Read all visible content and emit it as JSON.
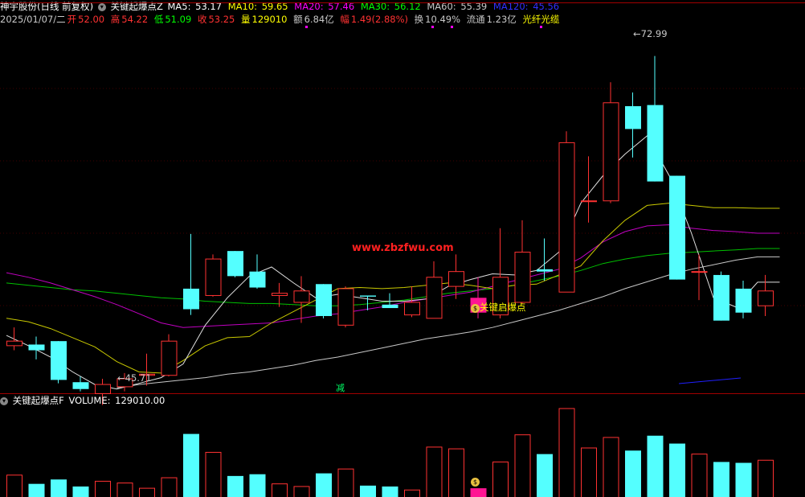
{
  "header": {
    "stock_name": "神宇股份(日线 前复权)",
    "indicator_name": "关键起爆点Z",
    "ma5": {
      "label": "MA5:",
      "value": "53.17",
      "color": "#ffffff"
    },
    "ma10": {
      "label": "MA10:",
      "value": "59.65",
      "color": "#ffff00"
    },
    "ma20": {
      "label": "MA20:",
      "value": "57.46",
      "color": "#ff00ff"
    },
    "ma30": {
      "label": "MA30:",
      "value": "56.12",
      "color": "#00ff00"
    },
    "ma60": {
      "label": "MA60:",
      "value": "55.39",
      "color": "#c0c0c0"
    },
    "ma120": {
      "label": "MA120:",
      "value": "45.56",
      "color": "#3030ff"
    }
  },
  "info": {
    "date": "2025/01/07/二",
    "open_label": "开",
    "open": "52.00",
    "high_label": "高",
    "high": "54.22",
    "low_label": "低",
    "low": "51.09",
    "close_label": "收",
    "close": "53.25",
    "vol_label": "量",
    "vol": "129010",
    "amount_label": "额",
    "amount": "6.84亿",
    "change_label": "幅",
    "change": "1.49(2.88%)",
    "turnover_label": "换",
    "turnover": "10.49%",
    "float_label": "流通",
    "float": "1.23亿",
    "concept": "光纤光缆"
  },
  "annotations": {
    "high_mark": "72.99",
    "low_mark": "45.71",
    "signal_label": "关键启爆点",
    "watermark": "www.zbzfwu.com",
    "reduce_badge": "减"
  },
  "volume_header": {
    "indicator_name": "关键起爆点F",
    "volume_label": "VOLUME:",
    "volume_value": "129010.00"
  },
  "colors": {
    "up": "#ff3232",
    "down": "#54ffff",
    "signal": "#ff1493",
    "border": "#a00000"
  },
  "chart_data": {
    "type": "candlestick",
    "price_range": [
      43.5,
      76.5
    ],
    "candles": [
      {
        "o": 47.6,
        "h": 49.2,
        "l": 47.2,
        "c": 48.0,
        "v": 25
      },
      {
        "o": 47.7,
        "h": 48.4,
        "l": 46.4,
        "c": 47.2,
        "v": 15
      },
      {
        "o": 48.0,
        "h": 48.0,
        "l": 44.3,
        "c": 44.6,
        "v": 20
      },
      {
        "o": 44.4,
        "h": 44.9,
        "l": 43.6,
        "c": 43.8,
        "v": 12
      },
      {
        "o": 43.4,
        "h": 44.7,
        "l": 42.4,
        "c": 44.2,
        "v": 18
      },
      {
        "o": 44.0,
        "h": 45.2,
        "l": 43.6,
        "c": 44.7,
        "v": 16
      },
      {
        "o": 45.0,
        "h": 46.9,
        "l": 44.1,
        "c": 45.1,
        "v": 10
      },
      {
        "o": 45.0,
        "h": 48.6,
        "l": 44.9,
        "c": 48.0,
        "v": 22
      },
      {
        "o": 52.6,
        "h": 57.4,
        "l": 50.3,
        "c": 50.8,
        "v": 72
      },
      {
        "o": 52.0,
        "h": 55.6,
        "l": 51.9,
        "c": 55.2,
        "v": 51
      },
      {
        "o": 55.9,
        "h": 55.9,
        "l": 53.6,
        "c": 53.7,
        "v": 24
      },
      {
        "o": 54.1,
        "h": 55.6,
        "l": 52.6,
        "c": 52.7,
        "v": 26
      },
      {
        "o": 52.0,
        "h": 53.1,
        "l": 51.0,
        "c": 52.2,
        "v": 15
      },
      {
        "o": 51.4,
        "h": 53.7,
        "l": 49.6,
        "c": 52.4,
        "v": 12
      },
      {
        "o": 53.0,
        "h": 53.0,
        "l": 50.0,
        "c": 50.2,
        "v": 27
      },
      {
        "o": 49.4,
        "h": 52.8,
        "l": 49.2,
        "c": 52.6,
        "v": 32
      },
      {
        "o": 52.0,
        "h": 52.0,
        "l": 50.7,
        "c": 51.9,
        "v": 13
      },
      {
        "o": 51.2,
        "h": 52.2,
        "l": 51.0,
        "c": 50.9,
        "v": 12
      },
      {
        "o": 50.3,
        "h": 52.8,
        "l": 50.1,
        "c": 51.4,
        "v": 8
      },
      {
        "o": 50.0,
        "h": 55.0,
        "l": 50.0,
        "c": 53.6,
        "v": 57
      },
      {
        "o": 52.8,
        "h": 55.6,
        "l": 51.7,
        "c": 54.1,
        "v": 55
      },
      {
        "o": 51.8,
        "h": 53.6,
        "l": 50.0,
        "c": 50.5,
        "v": 10
      },
      {
        "o": 50.3,
        "h": 57.9,
        "l": 50.0,
        "c": 53.6,
        "v": 40
      },
      {
        "o": 51.4,
        "h": 58.6,
        "l": 51.3,
        "c": 55.8,
        "v": 71
      },
      {
        "o": 54.3,
        "h": 57.0,
        "l": 53.3,
        "c": 54.1,
        "v": 49
      },
      {
        "o": 52.3,
        "h": 66.4,
        "l": 52.3,
        "c": 65.4,
        "v": 101
      },
      {
        "o": 60.3,
        "h": 64.2,
        "l": 58.4,
        "c": 60.3,
        "v": 56
      },
      {
        "o": 60.3,
        "h": 70.7,
        "l": 60.1,
        "c": 68.9,
        "v": 68
      },
      {
        "o": 68.6,
        "h": 69.8,
        "l": 64.1,
        "c": 66.6,
        "v": 53
      },
      {
        "o": 68.7,
        "h": 73.0,
        "l": 62.0,
        "c": 62.0,
        "v": 70
      },
      {
        "o": 62.5,
        "h": 57.4,
        "l": 59.7,
        "c": 53.4,
        "v": 61
      },
      {
        "o": 54.1,
        "h": 55.6,
        "l": 51.6,
        "c": 54.1,
        "v": 49
      },
      {
        "o": 53.8,
        "h": 54.1,
        "l": 49.8,
        "c": 49.8,
        "v": 40
      },
      {
        "o": 52.6,
        "h": 53.3,
        "l": 50.0,
        "c": 50.5,
        "v": 39
      },
      {
        "o": 51.1,
        "h": 53.8,
        "l": 50.2,
        "c": 52.4,
        "v": 42
      }
    ],
    "ma5": [
      48.5,
      47.6,
      46.6,
      45.3,
      44.2,
      43.8,
      44.3,
      44.8,
      46.0,
      49.4,
      51.8,
      53.7,
      54.5,
      53.1,
      51.8,
      52.1,
      51.8,
      51.5,
      51.5,
      51.7,
      52.8,
      53.4,
      53.9,
      53.8,
      54.2,
      55.8,
      60.1,
      62.5,
      64.4,
      66.0,
      62.5,
      57.5,
      51.8,
      51.0,
      53.17
    ],
    "ma10": [
      50.0,
      49.7,
      49.1,
      48.3,
      47.5,
      46.2,
      45.3,
      45.2,
      46.3,
      47.6,
      48.3,
      48.4,
      49.6,
      50.6,
      51.6,
      52.6,
      52.7,
      52.6,
      52.7,
      52.9,
      53.1,
      52.9,
      52.6,
      52.9,
      53.0,
      53.8,
      54.6,
      56.8,
      58.6,
      59.9,
      60.1,
      59.9,
      59.7,
      59.7,
      59.65
    ],
    "ma20": [
      54.0,
      53.6,
      53.1,
      52.5,
      51.9,
      51.2,
      50.4,
      49.6,
      49.2,
      49.3,
      49.4,
      49.5,
      49.6,
      49.9,
      50.2,
      50.4,
      50.7,
      51.0,
      51.4,
      51.7,
      52.0,
      52.3,
      52.8,
      53.3,
      53.8,
      54.3,
      55.3,
      56.7,
      57.6,
      58.1,
      58.2,
      57.9,
      57.7,
      57.6,
      57.46
    ],
    "ma30": [
      53.1,
      52.9,
      52.7,
      52.5,
      52.4,
      52.2,
      52.0,
      51.8,
      51.7,
      51.5,
      51.4,
      51.3,
      51.3,
      51.2,
      51.1,
      51.1,
      51.2,
      51.4,
      51.6,
      51.9,
      52.2,
      52.4,
      52.6,
      52.9,
      53.3,
      53.7,
      54.2,
      54.8,
      55.2,
      55.5,
      55.7,
      55.8,
      55.9,
      56.0,
      56.12
    ],
    "ma60": [
      null,
      null,
      null,
      null,
      null,
      43.9,
      44.2,
      44.4,
      44.6,
      44.8,
      45.1,
      45.3,
      45.6,
      45.9,
      46.3,
      46.6,
      47.0,
      47.4,
      47.8,
      48.2,
      48.5,
      48.8,
      49.2,
      49.7,
      50.2,
      50.7,
      51.3,
      51.9,
      52.6,
      53.2,
      53.8,
      54.3,
      54.7,
      55.1,
      55.39
    ],
    "ma120_segment": [
      [
        845,
        477
      ],
      [
        922,
        470
      ]
    ]
  }
}
